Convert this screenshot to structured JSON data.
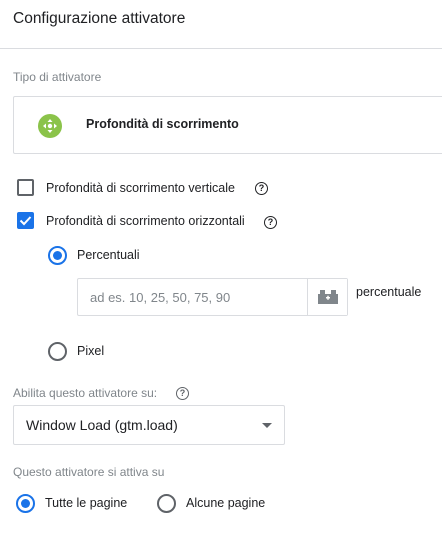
{
  "header": {
    "title": "Configurazione attivatore"
  },
  "trigger_type": {
    "label": "Tipo di attivatore",
    "name": "Profondità di scorrimento",
    "icon": "scroll-move-icon",
    "icon_color": "#8bc34a"
  },
  "vertical": {
    "label": "Profondità di scorrimento verticale",
    "checked": false
  },
  "horizontal": {
    "label": "Profondità di scorrimento orizzontali",
    "checked": true
  },
  "units": {
    "percent_label": "Percentuali",
    "percent_selected": true,
    "percent_placeholder": "ad es. 10, 25, 50, 75, 90",
    "percent_value": "",
    "percent_suffix": "percentuale",
    "pixel_label": "Pixel",
    "pixel_selected": false
  },
  "enable_on": {
    "label": "Abilita questo attivatore su:",
    "value": "Window Load (gtm.load)"
  },
  "fires_on": {
    "label": "Questo attivatore si attiva su",
    "all_pages_label": "Tutte le pagine",
    "all_pages_selected": true,
    "some_pages_label": "Alcune pagine",
    "some_pages_selected": false
  },
  "colors": {
    "accent": "#1a73e8",
    "border": "#dadce0",
    "muted_text": "#80868b"
  }
}
